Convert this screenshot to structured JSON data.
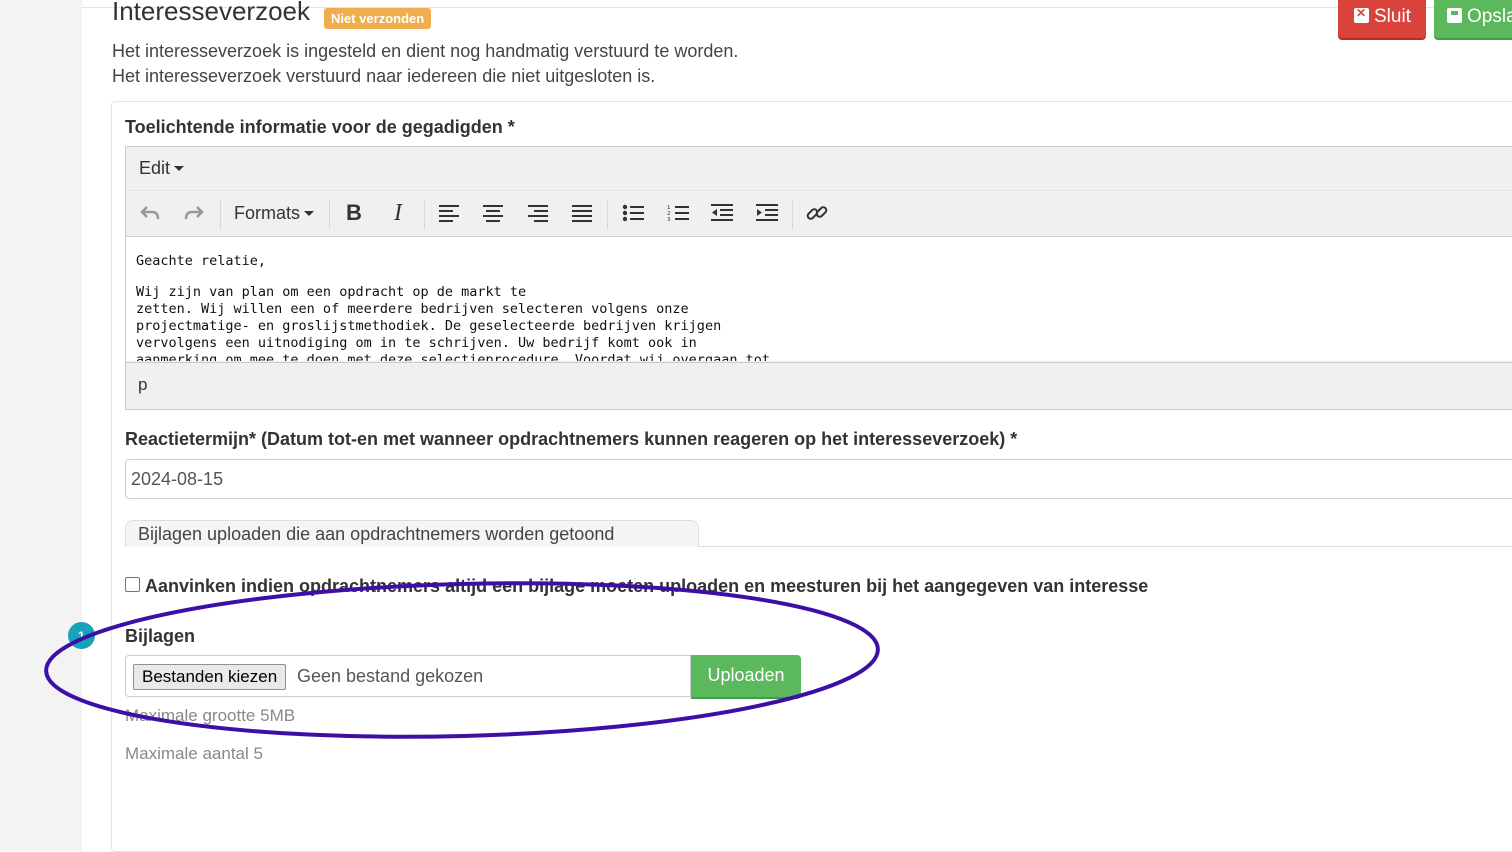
{
  "header": {
    "title": "Interesseverzoek",
    "status_badge": "Niet verzonden",
    "close_label": "Sluit",
    "save_label": "Opsla"
  },
  "description": {
    "line1": "Het interesseverzoek is ingesteld en dient nog handmatig verstuurd te worden.",
    "line2": "Het interesseverzoek verstuurd naar iedereen die niet uitgesloten is."
  },
  "editor_section": {
    "label": "Toelichtende informatie voor de gegadigden *",
    "menu_edit": "Edit",
    "formats_label": "Formats",
    "toolbar_icons": [
      "undo-icon",
      "redo-icon",
      "bold-icon",
      "italic-icon",
      "align-left-icon",
      "align-center-icon",
      "align-right-icon",
      "align-justify-icon",
      "bullet-list-icon",
      "numbered-list-icon",
      "outdent-icon",
      "indent-icon",
      "link-icon"
    ],
    "content": [
      "Geachte relatie,",
      "Wij zijn van plan om een opdracht op de markt te",
      "zetten. Wij willen een of meerdere bedrijven selecteren volgens onze",
      "projectmatige- en groslijstmethodiek. De geselecteerde bedrijven krijgen",
      "vervolgens een uitnodiging om in te schrijven. Uw bedrijf komt ook in",
      "aanmerking om mee te doen met deze selectieprocedure. Voordat wij overgaan tot"
    ],
    "statusbar_path": "p"
  },
  "deadline": {
    "label": "Reactietermijn* (Datum tot-en met wanneer opdrachtnemers kunnen reageren op het interesseverzoek) *",
    "value": "2024-08-15"
  },
  "attachments_tab": {
    "label": "Bijlagen uploaden die aan opdrachtnemers worden getoond"
  },
  "require_attachment": {
    "label": "Aanvinken indien opdrachtnemers altijd een bijlage moeten uploaden en meesturen bij het aangegeven van interesse",
    "checked": false
  },
  "attachments": {
    "step_number": "1",
    "label": "Bijlagen",
    "choose_button": "Bestanden kiezen",
    "no_file_text": "Geen bestand gekozen",
    "upload_button": "Uploaden",
    "max_size": "Maximale grootte 5MB",
    "max_count": "Maximale aantal 5"
  },
  "colors": {
    "badge": "#f0ad4e",
    "danger": "#d9433c",
    "success": "#5cb85c",
    "step_dot": "#17a2b8",
    "annotation_ellipse": "#3d0fa6"
  }
}
